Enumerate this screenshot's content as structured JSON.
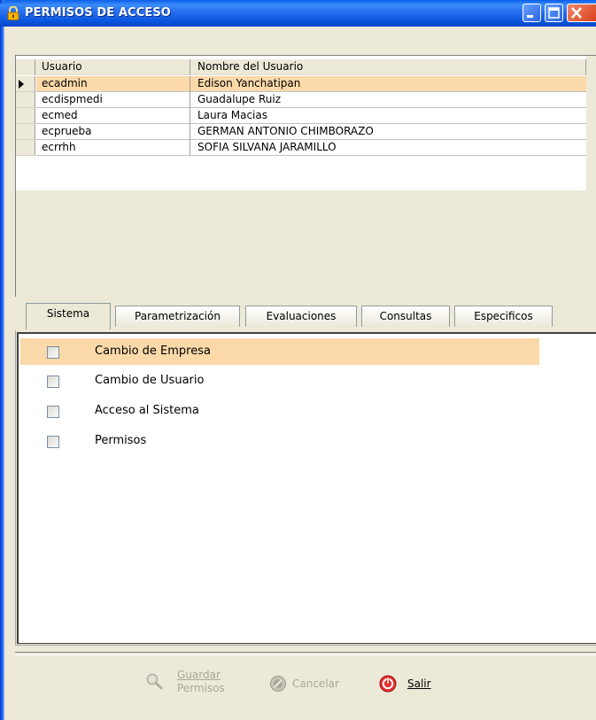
{
  "window": {
    "title": "PERMISOS DE ACCESO",
    "title_icon": "lock-icon",
    "controls": [
      "minimize-icon",
      "maximize-icon",
      "close-icon"
    ]
  },
  "users_grid": {
    "columns": [
      "Usuario",
      "Nombre del Usuario"
    ],
    "rows": [
      {
        "user": "ecadmin",
        "name": "Edison Yanchatipan",
        "selected": true
      },
      {
        "user": "ecdispmedi",
        "name": "Guadalupe Ruiz",
        "selected": false
      },
      {
        "user": "ecmed",
        "name": "Laura Macias",
        "selected": false
      },
      {
        "user": "ecprueba",
        "name": "GERMAN ANTONIO CHIMBORAZO",
        "selected": false
      },
      {
        "user": "ecrrhh",
        "name": "SOFIA SILVANA JARAMILLO",
        "selected": false
      }
    ]
  },
  "tabs": [
    "Sistema",
    "Parametrización",
    "Evaluaciones",
    "Consultas",
    "Especificos"
  ],
  "active_tab": "Sistema",
  "permissions": [
    {
      "label": "Cambio de Empresa",
      "checked": false,
      "highlighted": true
    },
    {
      "label": "Cambio de Usuario",
      "checked": false,
      "highlighted": false
    },
    {
      "label": "Acceso al Sistema",
      "checked": false,
      "highlighted": false
    },
    {
      "label": "Permisos",
      "checked": false,
      "highlighted": false
    }
  ],
  "buttons": {
    "guardar_line1": "Guardar",
    "guardar_line2": "Permisos",
    "cancelar": "Cancelar",
    "salir": "Salir"
  },
  "colors": {
    "selection": "#fbd9a9",
    "titlebar": "#0a55de",
    "face": "#ece9d8"
  }
}
